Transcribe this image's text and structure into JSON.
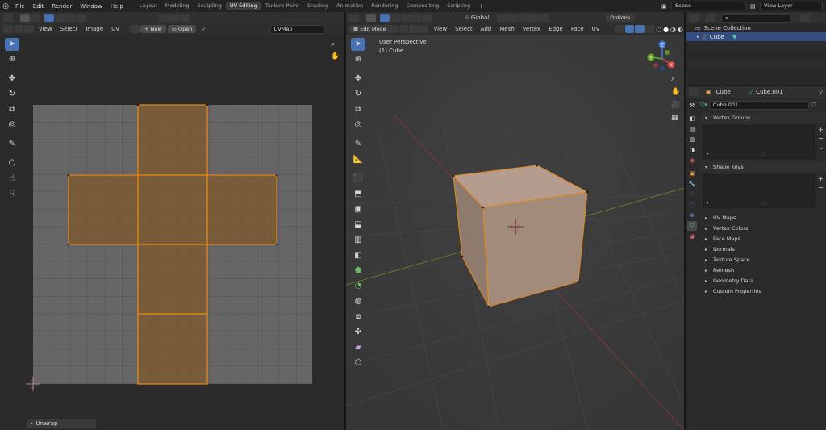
{
  "topbar": {
    "menus": [
      "File",
      "Edit",
      "Render",
      "Window",
      "Help"
    ],
    "workspace_tabs": [
      "Layout",
      "Modeling",
      "Sculpting",
      "UV Editing",
      "Texture Paint",
      "Shading",
      "Animation",
      "Rendering",
      "Compositing",
      "Scripting"
    ],
    "active_tab": "UV Editing",
    "add_tab": "+",
    "scene": "Scene",
    "view_layer": "View Layer"
  },
  "uv_editor": {
    "menus": [
      "View",
      "Select",
      "Image",
      "UV"
    ],
    "new_label": "New",
    "open_label": "Open",
    "uvmap": "UVMap",
    "last_op": "Unwrap"
  },
  "viewport": {
    "mode": "Edit Mode",
    "menus": [
      "View",
      "Select",
      "Add",
      "Mesh",
      "Vertex",
      "Edge",
      "Face",
      "UV"
    ],
    "orientation": "Global",
    "options": "Options",
    "info_line1": "User Perspective",
    "info_line2": "(1) Cube",
    "axes": {
      "x": "X",
      "y": "Y",
      "z": "Z"
    }
  },
  "outliner": {
    "search_placeholder": "",
    "collection": "Scene Collection",
    "object": "Cube"
  },
  "properties": {
    "object": "Cube",
    "mesh": "Cube.001",
    "mesh_field": "Cube.001",
    "open_panels": [
      "Vertex Groups",
      "Shape Keys"
    ],
    "closed_panels": [
      "UV Maps",
      "Vertex Colors",
      "Face Maps",
      "Normals",
      "Texture Space",
      "Remesh",
      "Geometry Data",
      "Custom Properties"
    ],
    "colors": {
      "accent": "#4772b3",
      "uv_face": "#7a5a34",
      "uv_edge": "#e88a1a",
      "cube_face": "#a08a7a"
    }
  }
}
